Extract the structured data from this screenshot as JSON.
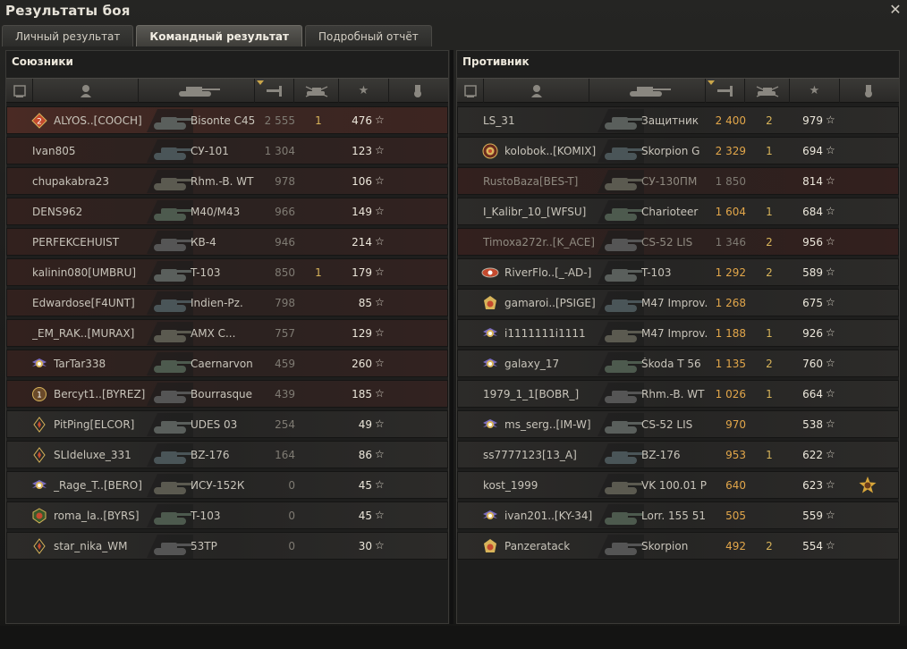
{
  "window": {
    "title": "Результаты боя"
  },
  "tabs": [
    {
      "label": "Личный результат",
      "active": false
    },
    {
      "label": "Командный результат",
      "active": true
    },
    {
      "label": "Подробный отчёт",
      "active": false
    }
  ],
  "allies": {
    "title": "Союзники",
    "rows": [
      {
        "player": "ALYOS..[COOCH]",
        "vehicle": "Bisonte C45",
        "damage": "2 555",
        "kills": "1",
        "xp": "476",
        "badge": "class-2-badge-icon",
        "state": "highlight"
      },
      {
        "player": "Ivan805",
        "vehicle": "СУ-101",
        "damage": "1 304",
        "kills": "",
        "xp": "123",
        "badge": "",
        "state": "alt"
      },
      {
        "player": "chupakabra23",
        "vehicle": "Rhm.-B. WT",
        "damage": "978",
        "kills": "",
        "xp": "106",
        "badge": "",
        "state": "alt"
      },
      {
        "player": "DENS962",
        "vehicle": "M40/M43",
        "damage": "966",
        "kills": "",
        "xp": "149",
        "badge": "",
        "state": "alt"
      },
      {
        "player": "PERFEKCEHUIST",
        "vehicle": "КВ-4",
        "damage": "946",
        "kills": "",
        "xp": "214",
        "badge": "",
        "state": "alt"
      },
      {
        "player": "kalinin080[UMBRU]",
        "vehicle": "T-103",
        "damage": "850",
        "kills": "1",
        "xp": "179",
        "badge": "",
        "state": "alt"
      },
      {
        "player": "Edwardose[F4UNT]",
        "vehicle": "Indien-Pz.",
        "damage": "798",
        "kills": "",
        "xp": "85",
        "badge": "",
        "state": "alt"
      },
      {
        "player": "_EM_RAK..[MURAX]",
        "vehicle": "AMX C...",
        "damage": "757",
        "kills": "",
        "xp": "129",
        "badge": "",
        "state": "alt"
      },
      {
        "player": "TarTar338",
        "vehicle": "Caernarvon",
        "damage": "459",
        "kills": "",
        "xp": "260",
        "badge": "wings-badge-icon",
        "state": "alt"
      },
      {
        "player": "Bercyt1..[BYREZ]",
        "vehicle": "Bourrasque",
        "damage": "439",
        "kills": "",
        "xp": "185",
        "badge": "class-1-badge-icon",
        "state": "alt"
      },
      {
        "player": "PitPing[ELCOR]",
        "vehicle": "UDES 03",
        "damage": "254",
        "kills": "",
        "xp": "49",
        "badge": "diamond-badge-icon",
        "state": "normal"
      },
      {
        "player": "SLIdeluxe_331",
        "vehicle": "BZ-176",
        "damage": "164",
        "kills": "",
        "xp": "86",
        "badge": "diamond-badge-icon",
        "state": "normal"
      },
      {
        "player": "_Rage_T..[BERO]",
        "vehicle": "ИСУ-152К",
        "damage": "0",
        "kills": "",
        "xp": "45",
        "badge": "wings-badge-icon",
        "state": "normal"
      },
      {
        "player": "roma_la..[BYRS]",
        "vehicle": "T-103",
        "damage": "0",
        "kills": "",
        "xp": "45",
        "badge": "shield-badge-icon",
        "state": "normal"
      },
      {
        "player": "star_nika_WM",
        "vehicle": "53TP",
        "damage": "0",
        "kills": "",
        "xp": "30",
        "badge": "diamond-badge-icon",
        "state": "normal"
      }
    ]
  },
  "enemies": {
    "title": "Противник",
    "rows": [
      {
        "player": "LS_31",
        "vehicle": "Защитник",
        "damage": "2 400",
        "kills": "2",
        "xp": "979",
        "badge": "",
        "state": "normal"
      },
      {
        "player": "kolobok..[KOMIX]",
        "vehicle": "Skorpion G",
        "damage": "2 329",
        "kills": "1",
        "xp": "694",
        "badge": "target-badge-icon",
        "state": "normal"
      },
      {
        "player": "RustoBaza[BES-T]",
        "vehicle": "СУ-130ПМ",
        "damage": "1 850",
        "kills": "",
        "xp": "814",
        "badge": "",
        "state": "dead"
      },
      {
        "player": "I_Kalibr_10_[WFSU]",
        "vehicle": "Charioteer",
        "damage": "1 604",
        "kills": "1",
        "xp": "684",
        "badge": "",
        "state": "normal"
      },
      {
        "player": "Timoxa272r..[K_ACE]",
        "vehicle": "CS-52 LIS",
        "damage": "1 346",
        "kills": "2",
        "xp": "956",
        "badge": "",
        "state": "dead"
      },
      {
        "player": "RiverFlo..[_-AD-]",
        "vehicle": "T-103",
        "damage": "1 292",
        "kills": "2",
        "xp": "589",
        "badge": "eye-badge-icon",
        "state": "normal"
      },
      {
        "player": "gamaroi..[PSIGE]",
        "vehicle": "M47 Improv.",
        "damage": "1 268",
        "kills": "",
        "xp": "675",
        "badge": "crest-badge-icon",
        "state": "normal"
      },
      {
        "player": "i1111111i1111",
        "vehicle": "M47 Improv.",
        "damage": "1 188",
        "kills": "1",
        "xp": "926",
        "badge": "wings-badge-icon",
        "state": "normal"
      },
      {
        "player": "galaxy_17",
        "vehicle": "Škoda T 56",
        "damage": "1 135",
        "kills": "2",
        "xp": "760",
        "badge": "wings-badge-icon",
        "state": "normal"
      },
      {
        "player": "1979_1_1[BOBR_]",
        "vehicle": "Rhm.-B. WT",
        "damage": "1 026",
        "kills": "1",
        "xp": "664",
        "badge": "",
        "state": "normal"
      },
      {
        "player": "ms_serg..[IM-W]",
        "vehicle": "CS-52 LIS",
        "damage": "970",
        "kills": "",
        "xp": "538",
        "badge": "wings-badge-icon",
        "state": "normal"
      },
      {
        "player": "ss7777123[13_A]",
        "vehicle": "BZ-176",
        "damage": "953",
        "kills": "1",
        "xp": "622",
        "badge": "",
        "state": "normal"
      },
      {
        "player": "kost_1999",
        "vehicle": "VK 100.01 P",
        "damage": "640",
        "kills": "",
        "xp": "623",
        "badge": "",
        "state": "normal",
        "medal": "medal-icon"
      },
      {
        "player": "ivan201..[KY-34]",
        "vehicle": "Lorr. 155 51",
        "damage": "505",
        "kills": "",
        "xp": "559",
        "badge": "wings-badge-icon",
        "state": "normal"
      },
      {
        "player": "Panzeratack",
        "vehicle": "Skorpion",
        "damage": "492",
        "kills": "2",
        "xp": "554",
        "badge": "crest-badge-icon",
        "state": "normal"
      }
    ]
  },
  "colors": {
    "accent": "#c9a64a",
    "damage_enemy": "#e2a64a",
    "ally_dead": "#3a2622"
  }
}
